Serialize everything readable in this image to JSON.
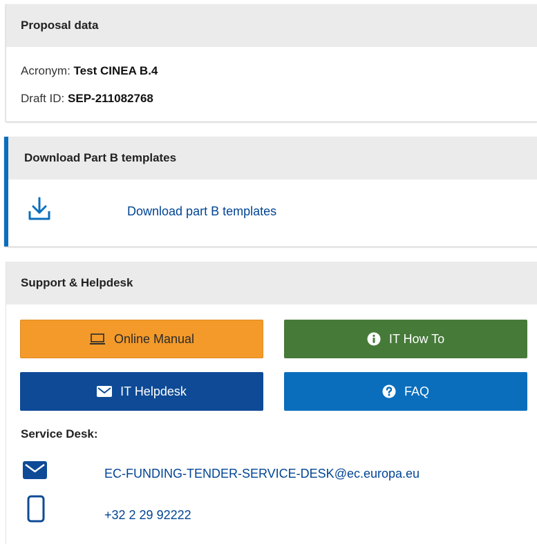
{
  "proposal": {
    "title": "Proposal data",
    "acronym_label": "Acronym:",
    "acronym_value": "Test CINEA B.4",
    "draft_label": "Draft ID:",
    "draft_value": "SEP-211082768"
  },
  "download": {
    "title": "Download Part B templates",
    "link_label": "Download part B templates",
    "icon": "download-icon"
  },
  "support": {
    "title": "Support & Helpdesk",
    "buttons": [
      {
        "label": "Online Manual",
        "icon": "laptop-icon",
        "color": "#f39a2b"
      },
      {
        "label": "IT How To",
        "icon": "info-icon",
        "color": "#467a39"
      },
      {
        "label": "IT Helpdesk",
        "icon": "envelope-icon",
        "color": "#0e4a96"
      },
      {
        "label": "FAQ",
        "icon": "question-icon",
        "color": "#0a6ebd"
      }
    ],
    "service_desk_title": "Service Desk:",
    "email": "EC-FUNDING-TENDER-SERVICE-DESK@ec.europa.eu",
    "phone": "+32 2 29 92222"
  },
  "colors": {
    "link": "#004494",
    "accent": "#0a6ebd",
    "header_bg": "#ebebeb"
  }
}
